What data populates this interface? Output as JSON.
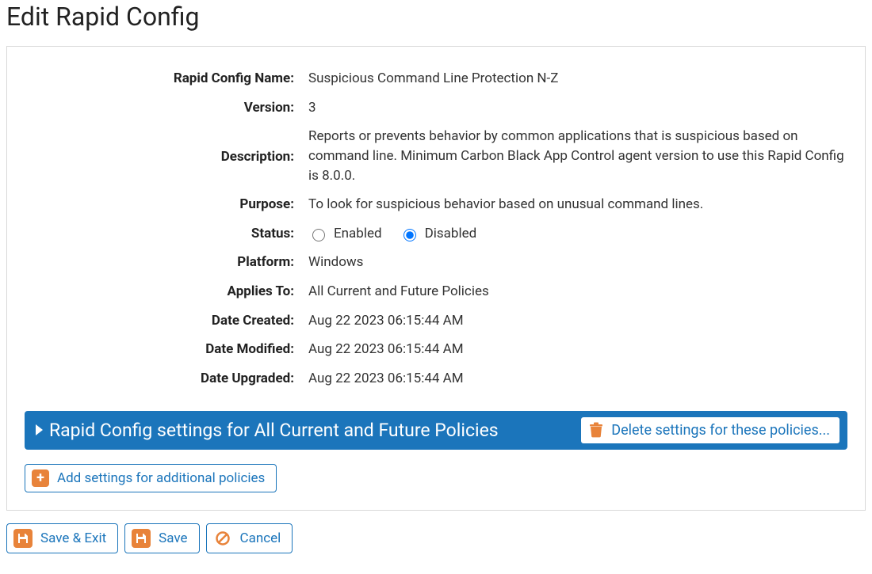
{
  "page_title": "Edit Rapid Config",
  "labels": {
    "name": "Rapid Config Name:",
    "version": "Version:",
    "description": "Description:",
    "purpose": "Purpose:",
    "status": "Status:",
    "platform": "Platform:",
    "applies_to": "Applies To:",
    "date_created": "Date Created:",
    "date_modified": "Date Modified:",
    "date_upgraded": "Date Upgraded:"
  },
  "values": {
    "name": "Suspicious Command Line Protection N-Z",
    "version": "3",
    "description": "Reports or prevents behavior by common applications that is suspicious based on command line. Minimum Carbon Black App Control agent version to use this Rapid Config is 8.0.0.",
    "purpose": "To look for suspicious behavior based on unusual command lines.",
    "platform": "Windows",
    "applies_to": "All Current and Future Policies",
    "date_created": "Aug 22 2023 06:15:44 AM",
    "date_modified": "Aug 22 2023 06:15:44 AM",
    "date_upgraded": "Aug 22 2023 06:15:44 AM"
  },
  "status_options": {
    "enabled": "Enabled",
    "disabled": "Disabled",
    "selected": "disabled"
  },
  "expander": {
    "title": "Rapid Config settings for All Current and Future Policies",
    "delete_label": "Delete settings for these policies..."
  },
  "add_settings_label": "Add settings for additional policies",
  "buttons": {
    "save_exit": "Save & Exit",
    "save": "Save",
    "cancel": "Cancel"
  }
}
